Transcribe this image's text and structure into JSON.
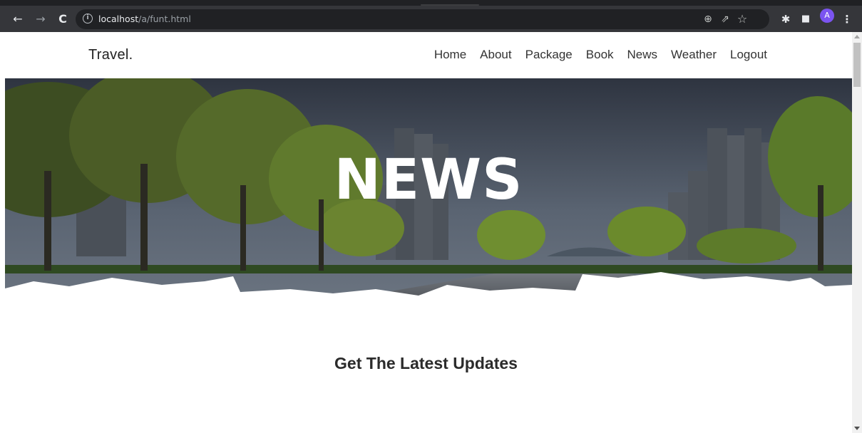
{
  "browser": {
    "back_glyph": "←",
    "forward_glyph": "→",
    "reload_glyph": "C",
    "info_glyph": "i",
    "url_host": "localhost",
    "url_path": "/a/funt.html",
    "zoom_glyph": "⊕",
    "share_glyph": "⇗",
    "star_glyph": "☆",
    "extensions_glyph": "✱",
    "sidepanel_glyph": "■",
    "avatar_letter": "A",
    "menu_glyph": "⋮"
  },
  "site": {
    "brand": "Travel.",
    "nav": [
      "Home",
      "About",
      "Package",
      "Book",
      "News",
      "Weather",
      "Logout"
    ]
  },
  "hero": {
    "title": "NEWS"
  },
  "section": {
    "title": "Get The Latest Updates"
  }
}
